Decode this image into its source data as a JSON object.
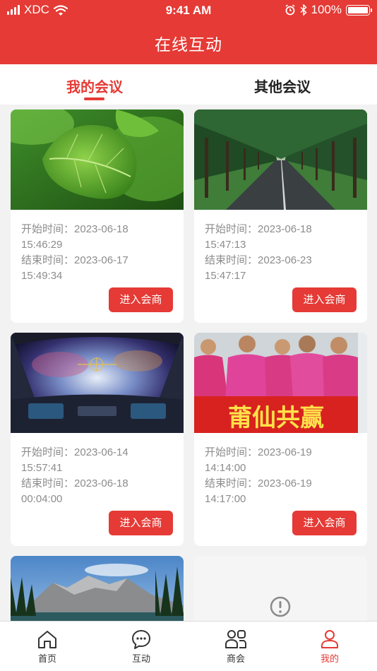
{
  "status_bar": {
    "carrier": "XDC",
    "time": "9:41 AM",
    "battery": "100%"
  },
  "header": {
    "title": "在线互动"
  },
  "tabs": [
    {
      "label": "我的会议",
      "active": true
    },
    {
      "label": "其他会议",
      "active": false
    }
  ],
  "meetings": [
    {
      "image": "green-leaves-photo",
      "start_label": "开始时间：",
      "start_date": "2023-06-18",
      "start_time": "15:46:29",
      "end_label": "结束时间：",
      "end_date": "2023-06-17",
      "end_time": "15:49:34",
      "button": "进入会商"
    },
    {
      "image": "tree-lined-road-photo",
      "start_label": "开始时间：",
      "start_date": "2023-06-18",
      "start_time": "15:47:13",
      "end_label": "结束时间：",
      "end_date": "2023-06-23",
      "end_time": "15:47:17",
      "button": "进入会商"
    },
    {
      "image": "spaceship-cockpit-photo",
      "start_label": "开始时间：",
      "start_date": "2023-06-14",
      "start_time": "15:57:41",
      "end_label": "结束时间：",
      "end_date": "2023-06-18",
      "end_time": "00:04:00",
      "button": "进入会商"
    },
    {
      "image": "group-photo",
      "banner_text": "莆仙共赢",
      "start_label": "开始时间：",
      "start_date": "2023-06-19",
      "start_time": "14:14:00",
      "end_label": "结束时间：",
      "end_date": "2023-06-19",
      "end_time": "14:17:00",
      "button": "进入会商"
    },
    {
      "image": "mountain-lake-photo"
    },
    {
      "image": "image-error-placeholder"
    }
  ],
  "tabbar": [
    {
      "label": "首页",
      "icon": "home-icon",
      "active": false
    },
    {
      "label": "互动",
      "icon": "chat-bubble-icon",
      "active": false
    },
    {
      "label": "商会",
      "icon": "group-icon",
      "active": false
    },
    {
      "label": "我的",
      "icon": "user-icon",
      "active": true
    }
  ],
  "colors": {
    "primary": "#e53a35",
    "text_muted": "#8c8c8c",
    "background": "#f2f2f2"
  }
}
